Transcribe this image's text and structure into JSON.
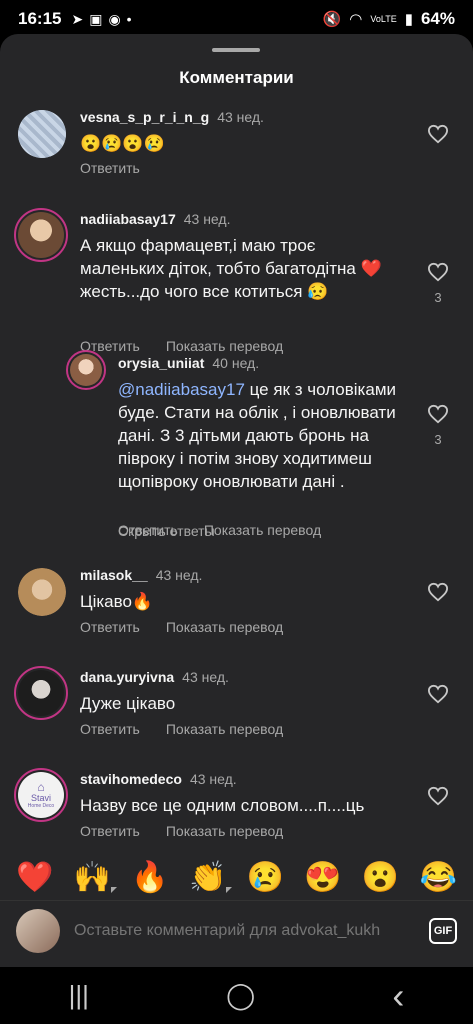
{
  "status": {
    "time": "16:15",
    "battery": "64%",
    "network": "VoLTE"
  },
  "sheet": {
    "title": "Комментарии"
  },
  "comments": [
    {
      "username": "vesna_s_p_r_i_n_g",
      "time": "43 нед.",
      "text": "😮😢😮😢",
      "actions": {
        "reply": "Ответить"
      },
      "avatar_color": "#b8c6d8"
    },
    {
      "username": "nadiiabasay17",
      "time": "43 нед.",
      "text_lines": [
        "А якщо фармацевт,і маю троє",
        "маленьких діток, тобто багатодітна ❤️",
        "жесть...до чого все котиться 😥"
      ],
      "likes": "3",
      "actions": {
        "reply": "Ответить",
        "translate": "Показать перевод"
      },
      "avatar_color": "#c9a07a"
    },
    {
      "username": "orysia_uniiat",
      "time": "40 нед.",
      "mention": "@nadiiabasay17",
      "text_first": " це як з чоловіками",
      "text_lines": [
        "буде. Стати на облік , і оновлювати",
        "дані. З 3 дітьми дають бронь на",
        "півроку і потім знову ходитимеш",
        "щопівроку оновлювати дані ."
      ],
      "likes": "3",
      "actions": {
        "reply": "Ответить",
        "translate": "Показать перевод"
      },
      "avatar_color": "#d9b49a"
    },
    {
      "hide_replies": "Скрыть ответы"
    },
    {
      "username": "milasok__",
      "time": "43 нед.",
      "text": "Цікаво🔥",
      "actions": {
        "reply": "Ответить",
        "translate": "Показать перевод"
      },
      "avatar_color": "#c7a87a"
    },
    {
      "username": "dana.yuryivna",
      "time": "43 нед.",
      "text": "Дуже цікаво",
      "actions": {
        "reply": "Ответить",
        "translate": "Показать перевод"
      },
      "avatar_color": "#3a3a3a"
    },
    {
      "username": "stavihomedeco",
      "time": "43 нед.",
      "text": "Назву все це одним словом....п....ць",
      "actions": {
        "reply": "Ответить",
        "translate": "Показать перевод"
      },
      "avatar_color": "#f2f2f2",
      "avatar_label": "Stavi",
      "avatar_sublabel": "Home Deco"
    }
  ],
  "reactions": [
    "❤️",
    "🙌",
    "🔥",
    "👏",
    "😢",
    "😍",
    "😮",
    "😂"
  ],
  "composer": {
    "placeholder": "Оставьте комментарий для advokat_kukh",
    "gif_label": "GIF"
  },
  "nav": {
    "recents": "|||",
    "home": "◯",
    "back": "‹"
  }
}
